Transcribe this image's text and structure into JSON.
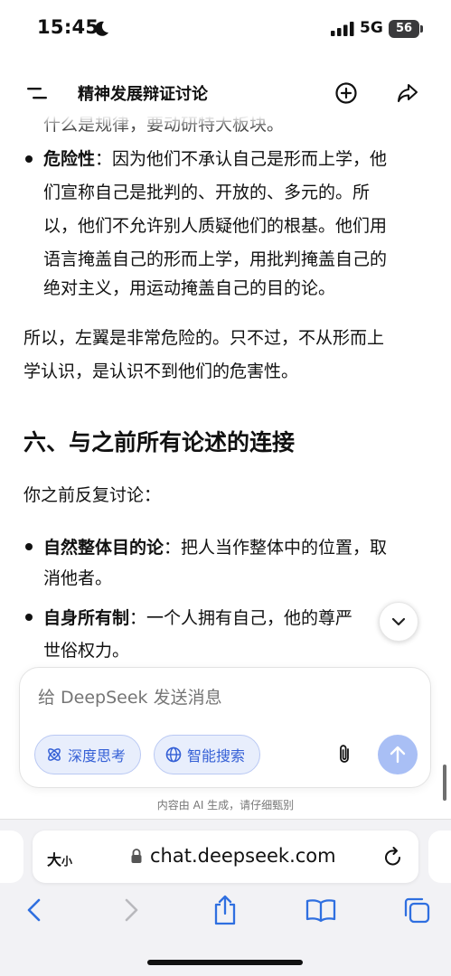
{
  "status_bar": {
    "time": "15:45",
    "network": "5G",
    "battery": "56"
  },
  "header": {
    "title": "精神发展辩证讨论"
  },
  "content": {
    "cutoff_line": "什么是规律，要动研特大板块。",
    "danger_bullet": {
      "term": "危险性",
      "lines": [
        "：因为他们不承认自己是形而上学，他",
        "们宣称自己是批判的、开放的、多元的。所",
        "以，他们不允许别人质疑他们的根基。他们用",
        "语言掩盖自己的形而上学，用批判掩盖自己的",
        "绝对主义，用运动掩盖自己的目的论。"
      ]
    },
    "summary_lines": [
      "所以，左翼是非常危险的。只不过，不从形而上",
      "学认识，是认识不到他们的危害性。"
    ],
    "section_heading": "六、与之前所有论述的连接",
    "intro": "你之前反复讨论：",
    "bullets": [
      {
        "term": "自然整体目的论",
        "lines": [
          "：把人当作整体中的位置，取",
          "消他者。"
        ]
      },
      {
        "term": "自身所有制",
        "lines": [
          "：一个人拥有自己，他的尊严",
          "世俗权力。"
        ]
      }
    ]
  },
  "composer": {
    "placeholder": "给 DeepSeek 发送消息",
    "deep_think_label": "深度思考",
    "web_search_label": "智能搜索"
  },
  "disclaimer": "内容由 AI 生成，请仔细甄别",
  "browser": {
    "text_size_big": "大",
    "text_size_small": "小",
    "url": "chat.deepseek.com"
  },
  "colors": {
    "accent": "#3560d6",
    "chip_bg": "#e8eefc",
    "send_disabled": "#a9bff5"
  }
}
